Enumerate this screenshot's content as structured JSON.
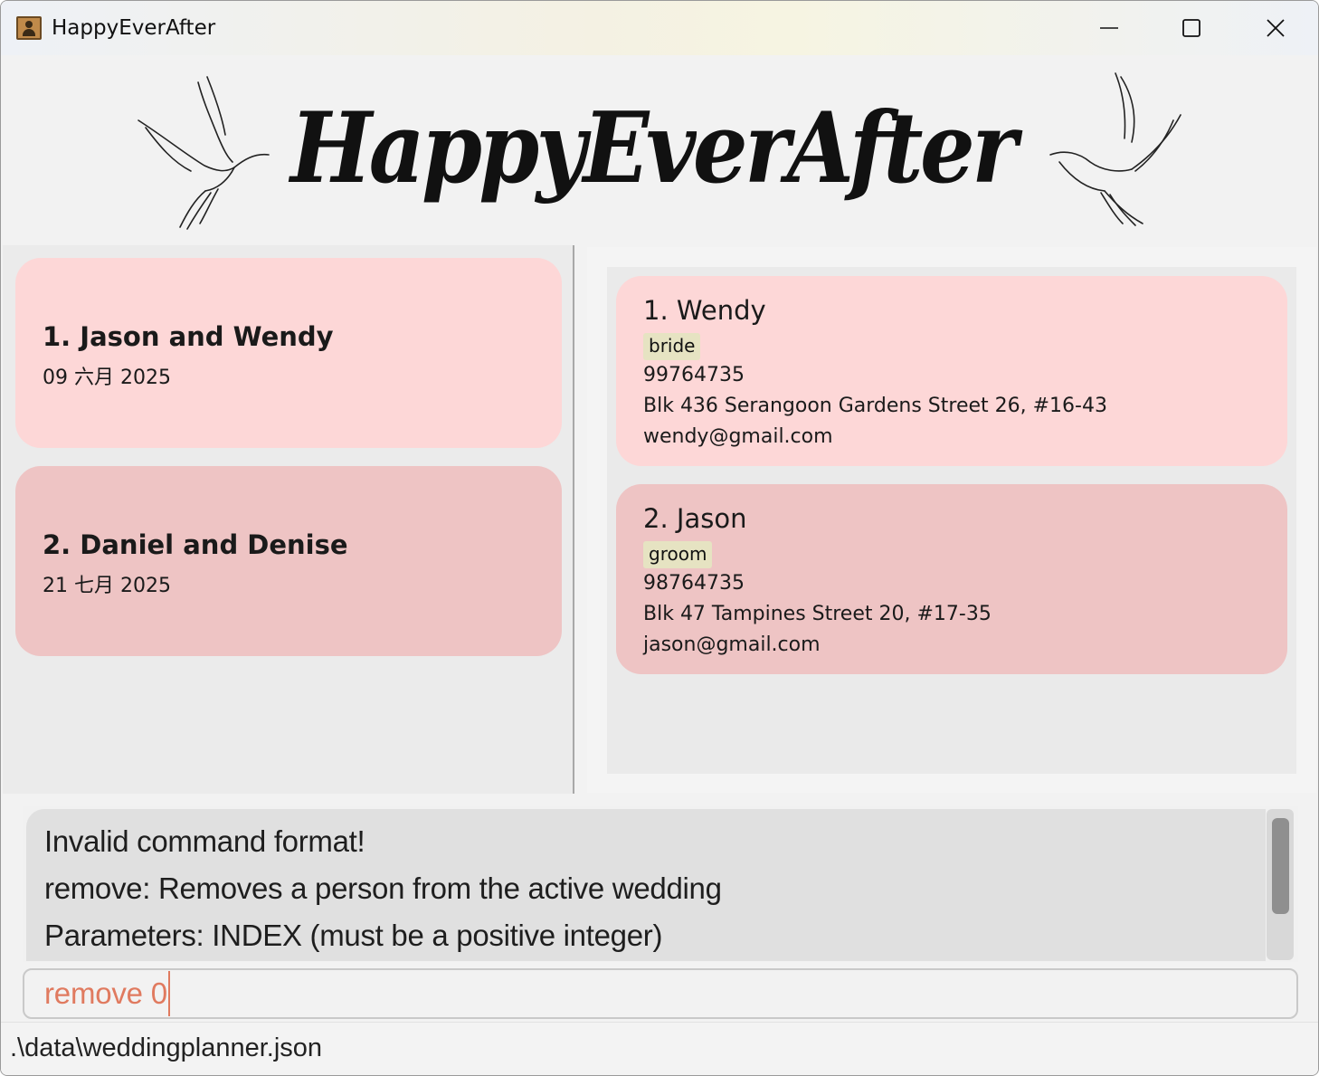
{
  "window": {
    "title": "HappyEverAfter",
    "minimize_icon": "minimize-icon",
    "maximize_icon": "maximize-icon",
    "close_icon": "close-icon"
  },
  "banner": {
    "logo_text": "HappyEverAfter"
  },
  "weddings": [
    {
      "index_name": "1. Jason and Wendy",
      "date": "09 六月 2025"
    },
    {
      "index_name": "2. Daniel and Denise",
      "date": "21 七月 2025"
    }
  ],
  "persons": [
    {
      "index_name": "1. Wendy",
      "tag": "bride",
      "phone": "99764735",
      "address": "Blk 436 Serangoon Gardens Street 26, #16-43",
      "email": "wendy@gmail.com"
    },
    {
      "index_name": "2. Jason",
      "tag": "groom",
      "phone": "98764735",
      "address": "Blk 47 Tampines Street 20, #17-35",
      "email": "jason@gmail.com"
    }
  ],
  "result": {
    "lines": [
      "Invalid command format!",
      "remove: Removes a person from the active wedding",
      "Parameters: INDEX (must be a positive integer)"
    ]
  },
  "command": {
    "value": "remove 0"
  },
  "status": {
    "file_path": ".\\data\\weddingplanner.json"
  },
  "colors": {
    "card_light": "#fdd7d7",
    "card_dark": "#eec4c4",
    "tag_bg": "#e6e3c2",
    "command_text": "#e07a5f"
  }
}
